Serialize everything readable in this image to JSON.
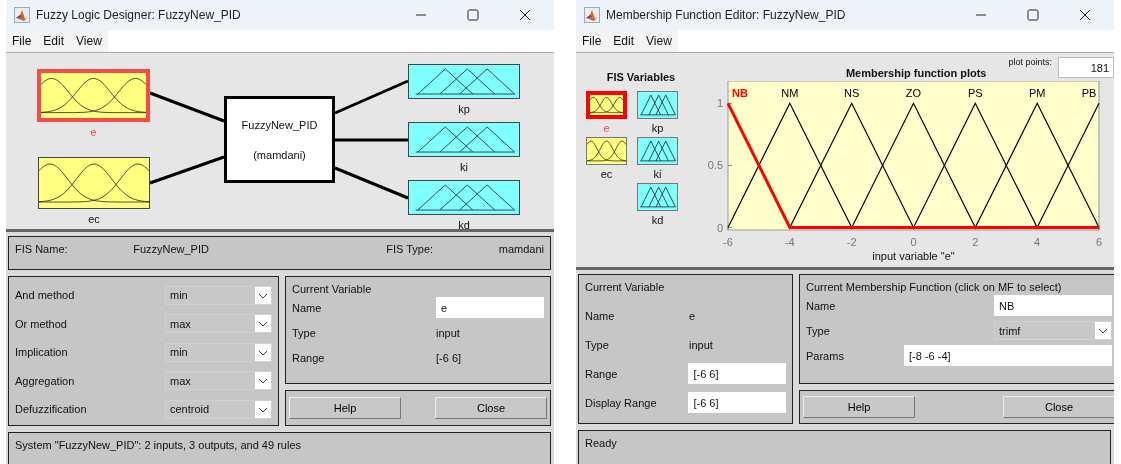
{
  "designer": {
    "title": "Fuzzy Logic Designer: FuzzyNew_PID",
    "menu": [
      "File",
      "Edit",
      "View"
    ],
    "inputs": [
      {
        "name": "e",
        "selected": true
      },
      {
        "name": "ec",
        "selected": false
      }
    ],
    "system": {
      "name": "FuzzyNew_PID",
      "type": "(mamdani)"
    },
    "outputs": [
      {
        "name": "kp",
        "selected": false
      },
      {
        "name": "ki",
        "selected": false
      },
      {
        "name": "kd",
        "selected": false
      }
    ],
    "fis_info": {
      "name_label": "FIS Name:",
      "name": "FuzzyNew_PID",
      "type_label": "FIS Type:",
      "type": "mamdani"
    },
    "methods": [
      {
        "label": "And method",
        "value": "min"
      },
      {
        "label": "Or method",
        "value": "max"
      },
      {
        "label": "Implication",
        "value": "min"
      },
      {
        "label": "Aggregation",
        "value": "max"
      },
      {
        "label": "Defuzzification",
        "value": "centroid"
      }
    ],
    "current_variable": {
      "title": "Current Variable",
      "fields": [
        {
          "label": "Name",
          "value": "e",
          "kind": "input"
        },
        {
          "label": "Type",
          "value": "input",
          "kind": "text"
        },
        {
          "label": "Range",
          "value": "[-6 6]",
          "kind": "text"
        }
      ]
    },
    "buttons": [
      "Help",
      "Close"
    ],
    "status": "System \"FuzzyNew_PID\": 2 inputs, 3 outputs, and 49 rules"
  },
  "editor": {
    "title": "Membership Function Editor: FuzzyNew_PID",
    "menu": [
      "File",
      "Edit",
      "View"
    ],
    "variables_title": "FIS Variables",
    "inputs": [
      {
        "name": "e",
        "selected": true
      },
      {
        "name": "ec",
        "selected": false
      }
    ],
    "outputs": [
      {
        "name": "kp",
        "selected": false
      },
      {
        "name": "ki",
        "selected": false
      },
      {
        "name": "kd",
        "selected": false
      }
    ],
    "plot_points_label": "plot points:",
    "plot_points": "181",
    "chart_data": {
      "type": "line",
      "title": "Membership function plots",
      "xlabel": "input variable \"e\"",
      "x": [
        -6,
        -4,
        -2,
        0,
        2,
        4,
        6
      ],
      "xlim": [
        -6,
        6
      ],
      "ylim": [
        -0.02,
        1.18
      ],
      "xticks": [
        -6,
        -4,
        -2,
        0,
        2,
        4,
        6
      ],
      "yticks": [
        0,
        0.5,
        1
      ],
      "series": [
        {
          "name": "NB",
          "color": "#ff0000",
          "values": [
            1,
            0,
            0,
            0,
            0,
            0,
            0
          ]
        },
        {
          "name": "NM",
          "color": "#000000",
          "values": [
            0,
            1,
            0,
            null,
            null,
            null,
            null
          ]
        },
        {
          "name": "NS",
          "color": "#000000",
          "values": [
            null,
            0,
            1,
            0,
            null,
            null,
            null
          ]
        },
        {
          "name": "ZO",
          "color": "#000000",
          "values": [
            null,
            null,
            0,
            1,
            0,
            null,
            null
          ]
        },
        {
          "name": "PS",
          "color": "#000000",
          "values": [
            null,
            null,
            null,
            0,
            1,
            0,
            null
          ]
        },
        {
          "name": "PM",
          "color": "#000000",
          "values": [
            null,
            null,
            null,
            null,
            0,
            1,
            0
          ]
        },
        {
          "name": "PB",
          "color": "#000000",
          "values": [
            null,
            null,
            null,
            null,
            null,
            0,
            1
          ]
        }
      ]
    },
    "current_variable": {
      "title": "Current Variable",
      "fields": [
        {
          "label": "Name",
          "value": "e",
          "kind": "text"
        },
        {
          "label": "Type",
          "value": "input",
          "kind": "text"
        },
        {
          "label": "Range",
          "value": "[-6 6]",
          "kind": "input"
        },
        {
          "label": "Display Range",
          "value": "[-6 6]",
          "kind": "input"
        }
      ]
    },
    "current_mf": {
      "title": "Current Membership Function (click on MF to select)",
      "fields": [
        {
          "label": "Name",
          "value": "NB",
          "kind": "input"
        },
        {
          "label": "Type",
          "value": "trimf",
          "kind": "dropdown"
        },
        {
          "label": "Params",
          "value": "[-8 -6 -4]",
          "kind": "wide"
        }
      ]
    },
    "buttons": [
      "Help",
      "Close"
    ],
    "status": "Ready"
  }
}
